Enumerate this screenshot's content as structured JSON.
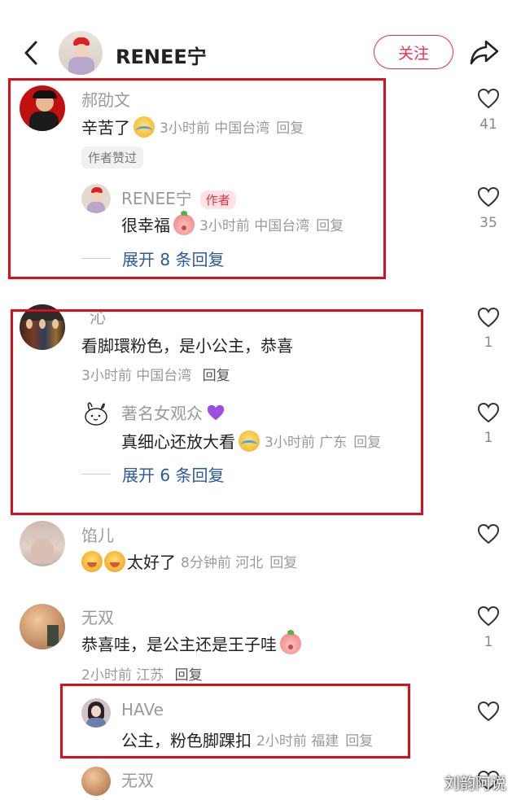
{
  "header": {
    "username": "RENEE宁",
    "follow_label": "关注"
  },
  "comments": [
    {
      "name": "郝劭文",
      "text": "辛苦了",
      "meta": "3小时前 中国台湾",
      "reply_label": "回复",
      "badge": "作者赞过",
      "likes": "41",
      "reply": {
        "name": "RENEE宁",
        "author_tag": "作者",
        "text": "很幸福",
        "meta": "3小时前 中国台湾",
        "reply_label": "回复",
        "likes": "35"
      },
      "expand_label": "展开 8 条回复"
    },
    {
      "name": "沁",
      "text": "看脚環粉色，是小公主，恭喜",
      "meta": "3小时前 中国台湾",
      "reply_label": "回复",
      "likes": "1",
      "reply": {
        "name": "著名女观众",
        "text": "真细心还放大看",
        "meta": "3小时前 广东",
        "reply_label": "回复",
        "likes": "1"
      },
      "expand_label": "展开 6 条回复"
    },
    {
      "name": "馅儿",
      "text": "太好了",
      "meta": "8分钟前 河北",
      "reply_label": "回复"
    },
    {
      "name": "无双",
      "text": "恭喜哇，是公主还是王子哇",
      "meta": "2小时前 江苏",
      "reply_label": "回复",
      "likes": "1",
      "reply": {
        "name": "HAVe",
        "text": "公主，粉色脚踝扣",
        "meta": "2小时前 福建",
        "reply_label": "回复"
      },
      "next_reply": {
        "name": "无双"
      }
    }
  ],
  "watermark": "刘韵阿说",
  "colors": {
    "accent_red": "#e8304a",
    "highlight_box": "#d8101e",
    "link_blue": "#2c5a9a"
  }
}
